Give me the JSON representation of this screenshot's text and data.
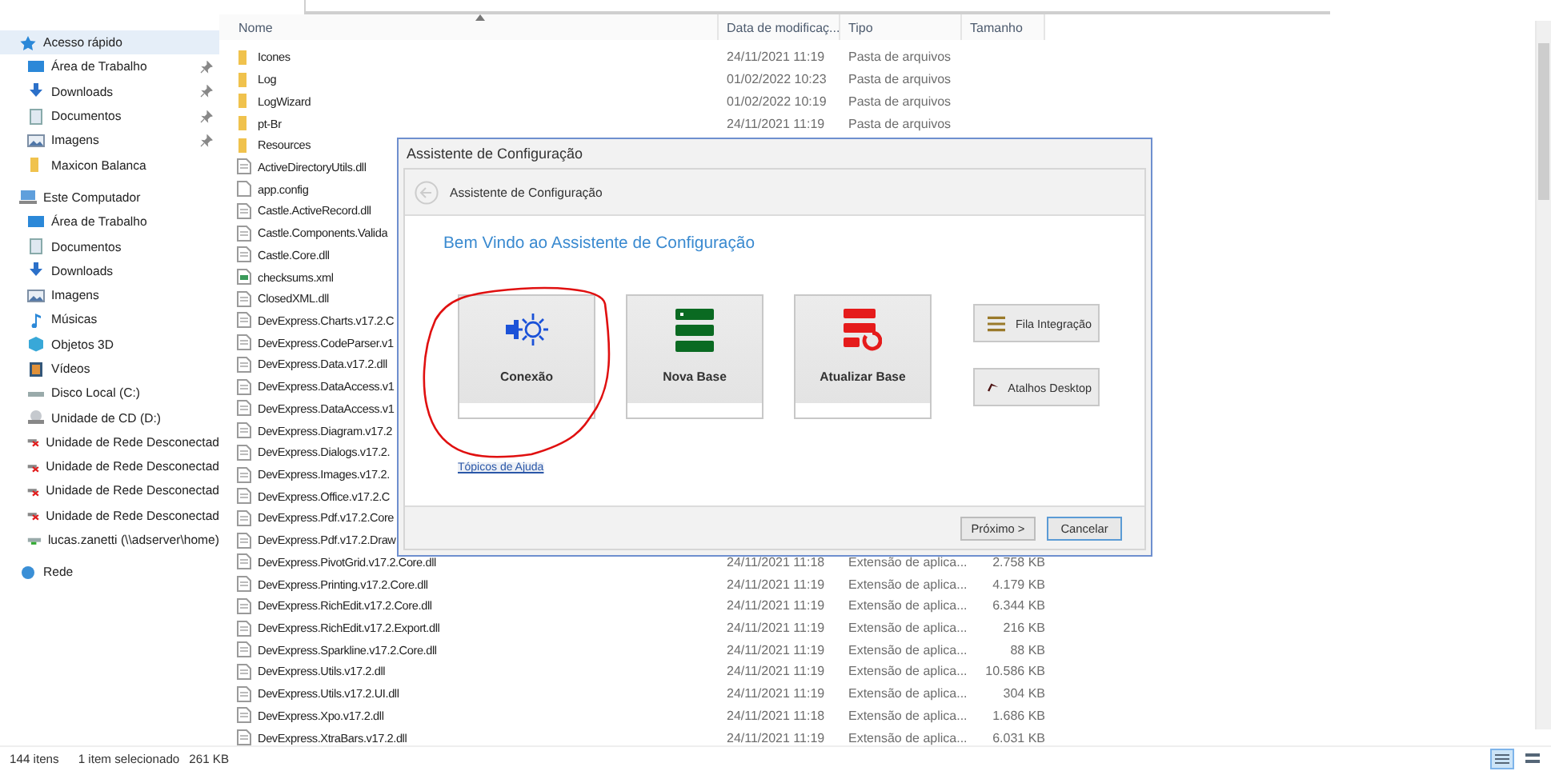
{
  "sidebar": {
    "items": [
      {
        "label": "Acesso rápido",
        "kind": "star",
        "children": [
          {
            "label": "Área de Trabalho",
            "kind": "desktop",
            "pinned": true
          },
          {
            "label": "Downloads",
            "kind": "download",
            "pinned": true
          },
          {
            "label": "Documentos",
            "kind": "document",
            "pinned": true
          },
          {
            "label": "Imagens",
            "kind": "picture",
            "pinned": true
          },
          {
            "label": "Maxicon Balanca",
            "kind": "folder",
            "pinned": false
          }
        ]
      },
      {
        "label": "Este Computador",
        "kind": "computer",
        "children": [
          {
            "label": "Área de Trabalho",
            "kind": "desktop"
          },
          {
            "label": "Documentos",
            "kind": "document"
          },
          {
            "label": "Downloads",
            "kind": "download"
          },
          {
            "label": "Imagens",
            "kind": "picture"
          },
          {
            "label": "Músicas",
            "kind": "music"
          },
          {
            "label": "Objetos 3D",
            "kind": "cube"
          },
          {
            "label": "Vídeos",
            "kind": "film"
          },
          {
            "label": "Disco Local (C:)",
            "kind": "drive"
          },
          {
            "label": "Unidade de CD (D:)",
            "kind": "cd"
          },
          {
            "label": "Unidade de Rede Desconectad",
            "kind": "netdrive-off"
          },
          {
            "label": "Unidade de Rede Desconectad",
            "kind": "netdrive-off"
          },
          {
            "label": "Unidade de Rede Desconectad",
            "kind": "netdrive-off"
          },
          {
            "label": "Unidade de Rede Desconectad",
            "kind": "netdrive-off"
          },
          {
            "label": "lucas.zanetti (\\\\adserver\\home)",
            "kind": "netdrive"
          }
        ]
      },
      {
        "label": "Rede",
        "kind": "network"
      }
    ]
  },
  "file_list": {
    "columns": [
      "Nome",
      "Data de modificaç...",
      "Tipo",
      "Tamanho"
    ],
    "rows": [
      {
        "name": "Icones",
        "kind": "folder",
        "date": "24/11/2021 11:19",
        "type": "Pasta de arquivos"
      },
      {
        "name": "Log",
        "kind": "folder",
        "date": "01/02/2022 10:23",
        "type": "Pasta de arquivos"
      },
      {
        "name": "LogWizard",
        "kind": "folder",
        "date": "01/02/2022 10:19",
        "type": "Pasta de arquivos"
      },
      {
        "name": "pt-Br",
        "kind": "folder",
        "date": "24/11/2021 11:19",
        "type": "Pasta de arquivos"
      },
      {
        "name": "Resources",
        "kind": "folder"
      },
      {
        "name": "ActiveDirectoryUtils.dll",
        "kind": "dll"
      },
      {
        "name": "app.config",
        "kind": "config"
      },
      {
        "name": "Castle.ActiveRecord.dll",
        "kind": "dll"
      },
      {
        "name": "Castle.Components.Valida",
        "kind": "dll"
      },
      {
        "name": "Castle.Core.dll",
        "kind": "dll"
      },
      {
        "name": "checksums.xml",
        "kind": "xml"
      },
      {
        "name": "ClosedXML.dll",
        "kind": "dll"
      },
      {
        "name": "DevExpress.Charts.v17.2.C",
        "kind": "dll"
      },
      {
        "name": "DevExpress.CodeParser.v1",
        "kind": "dll"
      },
      {
        "name": "DevExpress.Data.v17.2.dll",
        "kind": "dll"
      },
      {
        "name": "DevExpress.DataAccess.v1",
        "kind": "dll"
      },
      {
        "name": "DevExpress.DataAccess.v1",
        "kind": "dll"
      },
      {
        "name": "DevExpress.Diagram.v17.2",
        "kind": "dll"
      },
      {
        "name": "DevExpress.Dialogs.v17.2.",
        "kind": "dll"
      },
      {
        "name": "DevExpress.Images.v17.2.",
        "kind": "dll"
      },
      {
        "name": "DevExpress.Office.v17.2.C",
        "kind": "dll"
      },
      {
        "name": "DevExpress.Pdf.v17.2.Core",
        "kind": "dll"
      },
      {
        "name": "DevExpress.Pdf.v17.2.Draw",
        "kind": "dll"
      },
      {
        "name": "DevExpress.PivotGrid.v17.2.Core.dll",
        "kind": "dll",
        "date": "24/11/2021 11:18",
        "type": "Extensão de aplica...",
        "size": "2.758 KB"
      },
      {
        "name": "DevExpress.Printing.v17.2.Core.dll",
        "kind": "dll",
        "date": "24/11/2021 11:19",
        "type": "Extensão de aplica...",
        "size": "4.179 KB"
      },
      {
        "name": "DevExpress.RichEdit.v17.2.Core.dll",
        "kind": "dll",
        "date": "24/11/2021 11:19",
        "type": "Extensão de aplica...",
        "size": "6.344 KB"
      },
      {
        "name": "DevExpress.RichEdit.v17.2.Export.dll",
        "kind": "dll",
        "date": "24/11/2021 11:19",
        "type": "Extensão de aplica...",
        "size": "216 KB"
      },
      {
        "name": "DevExpress.Sparkline.v17.2.Core.dll",
        "kind": "dll",
        "date": "24/11/2021 11:19",
        "type": "Extensão de aplica...",
        "size": "88 KB"
      },
      {
        "name": "DevExpress.Utils.v17.2.dll",
        "kind": "dll",
        "date": "24/11/2021 11:19",
        "type": "Extensão de aplica...",
        "size": "10.586 KB"
      },
      {
        "name": "DevExpress.Utils.v17.2.UI.dll",
        "kind": "dll",
        "date": "24/11/2021 11:19",
        "type": "Extensão de aplica...",
        "size": "304 KB"
      },
      {
        "name": "DevExpress.Xpo.v17.2.dll",
        "kind": "dll",
        "date": "24/11/2021 11:18",
        "type": "Extensão de aplica...",
        "size": "1.686 KB"
      },
      {
        "name": "DevExpress.XtraBars.v17.2.dll",
        "kind": "dll",
        "date": "24/11/2021 11:19",
        "type": "Extensão de aplica...",
        "size": "6.031 KB"
      }
    ]
  },
  "status_bar": {
    "count": "144 itens",
    "selection": "1 item selecionado",
    "size": "261 KB",
    "views": [
      {
        "kind": "details",
        "selected": true
      },
      {
        "kind": "tiles",
        "selected": false
      }
    ]
  },
  "dialog": {
    "title": "Assistente de Configuração",
    "header": "Assistente de Configuração",
    "heading": "Bem Vindo ao Assistente de Configuração",
    "tiles": [
      {
        "label": "Conexão",
        "kind": "connection",
        "circled": true
      },
      {
        "label": "Nova Base",
        "kind": "database"
      },
      {
        "label": "Atualizar Base",
        "kind": "update"
      }
    ],
    "side_buttons": [
      {
        "label": "Fila Integração",
        "kind": "queue"
      },
      {
        "label": "Atalhos Desktop",
        "kind": "shortcut"
      }
    ],
    "help_link": "Tópicos de Ajuda",
    "buttons": [
      {
        "label": "Próximo >",
        "selected": false
      },
      {
        "label": "Cancelar",
        "selected": true
      }
    ]
  }
}
